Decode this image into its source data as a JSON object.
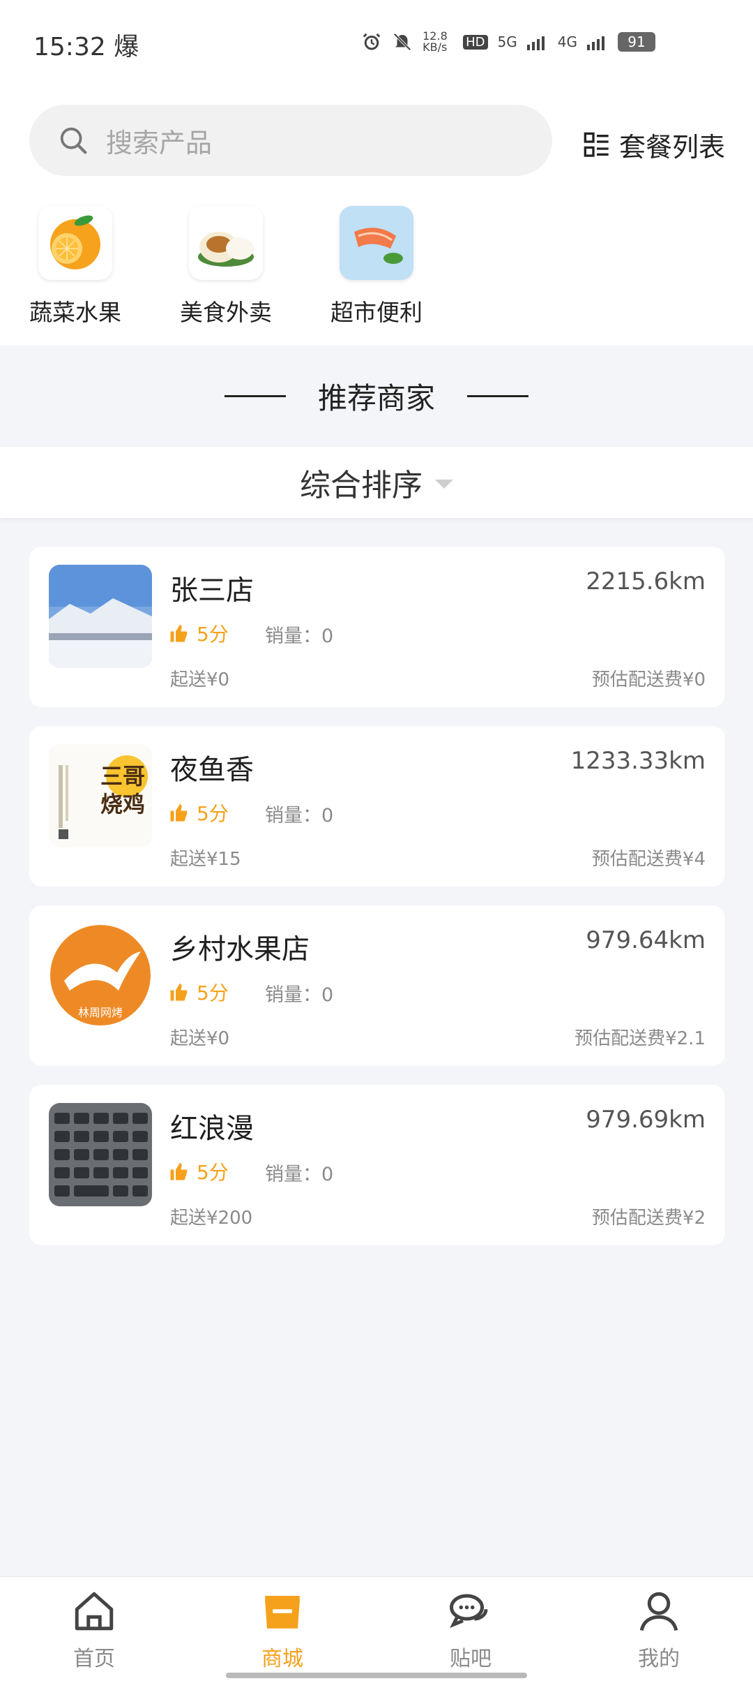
{
  "status_bar": {
    "time": "15:32",
    "extra": "爆",
    "speed": "12.8 KB/s",
    "hd": "HD",
    "net5g": "5G",
    "net4g": "4G",
    "battery": "91"
  },
  "search": {
    "placeholder": "搜索产品",
    "package_label": "套餐列表"
  },
  "categories": [
    {
      "label": "蔬菜水果",
      "icon": "orange-fruit-icon"
    },
    {
      "label": "美食外卖",
      "icon": "steamed-bun-icon"
    },
    {
      "label": "超市便利",
      "icon": "salmon-icon"
    }
  ],
  "section_title": "推荐商家",
  "sort_label": "综合排序",
  "shops": [
    {
      "name": "张三店",
      "distance": "2215.6km",
      "rating": "5分",
      "sales": "销量：0",
      "min_order": "起送¥0",
      "delivery_fee": "预估配送费¥0"
    },
    {
      "name": "夜鱼香",
      "distance": "1233.33km",
      "rating": "5分",
      "sales": "销量：0",
      "min_order": "起送¥15",
      "delivery_fee": "预估配送费¥4"
    },
    {
      "name": "乡村水果店",
      "distance": "979.64km",
      "rating": "5分",
      "sales": "销量：0",
      "min_order": "起送¥0",
      "delivery_fee": "预估配送费¥2.1"
    },
    {
      "name": "红浪漫",
      "distance": "979.69km",
      "rating": "5分",
      "sales": "销量：0",
      "min_order": "起送¥200",
      "delivery_fee": "预估配送费¥2"
    }
  ],
  "shop_images": {
    "poster_text": "三哥烧鸡",
    "logo_text": "林周网烤"
  },
  "tabs": [
    {
      "label": "首页",
      "icon": "home-icon"
    },
    {
      "label": "商城",
      "icon": "shop-icon",
      "active": true
    },
    {
      "label": "贴吧",
      "icon": "chat-icon"
    },
    {
      "label": "我的",
      "icon": "user-icon"
    }
  ],
  "colors": {
    "accent": "#f5a11c",
    "background": "#f4f5f9"
  }
}
